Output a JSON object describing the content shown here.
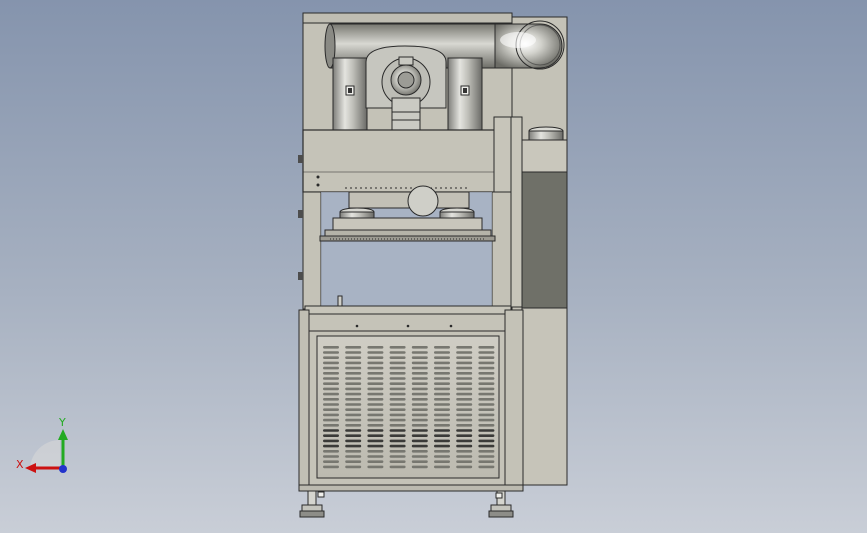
{
  "viewport": {
    "background_top": "#8594ad",
    "background_bottom": "#c9ced7"
  },
  "model": {
    "body_color": "#c5c3b8",
    "duct_color": "#b9b9b4",
    "edge_color": "#2a2a2a",
    "panel_dark_color": "#6f7068"
  },
  "triad": {
    "x_label": "X",
    "y_label": "Y",
    "x_color": "#cc1111",
    "y_color": "#22aa22",
    "z_color": "#2233cc"
  }
}
